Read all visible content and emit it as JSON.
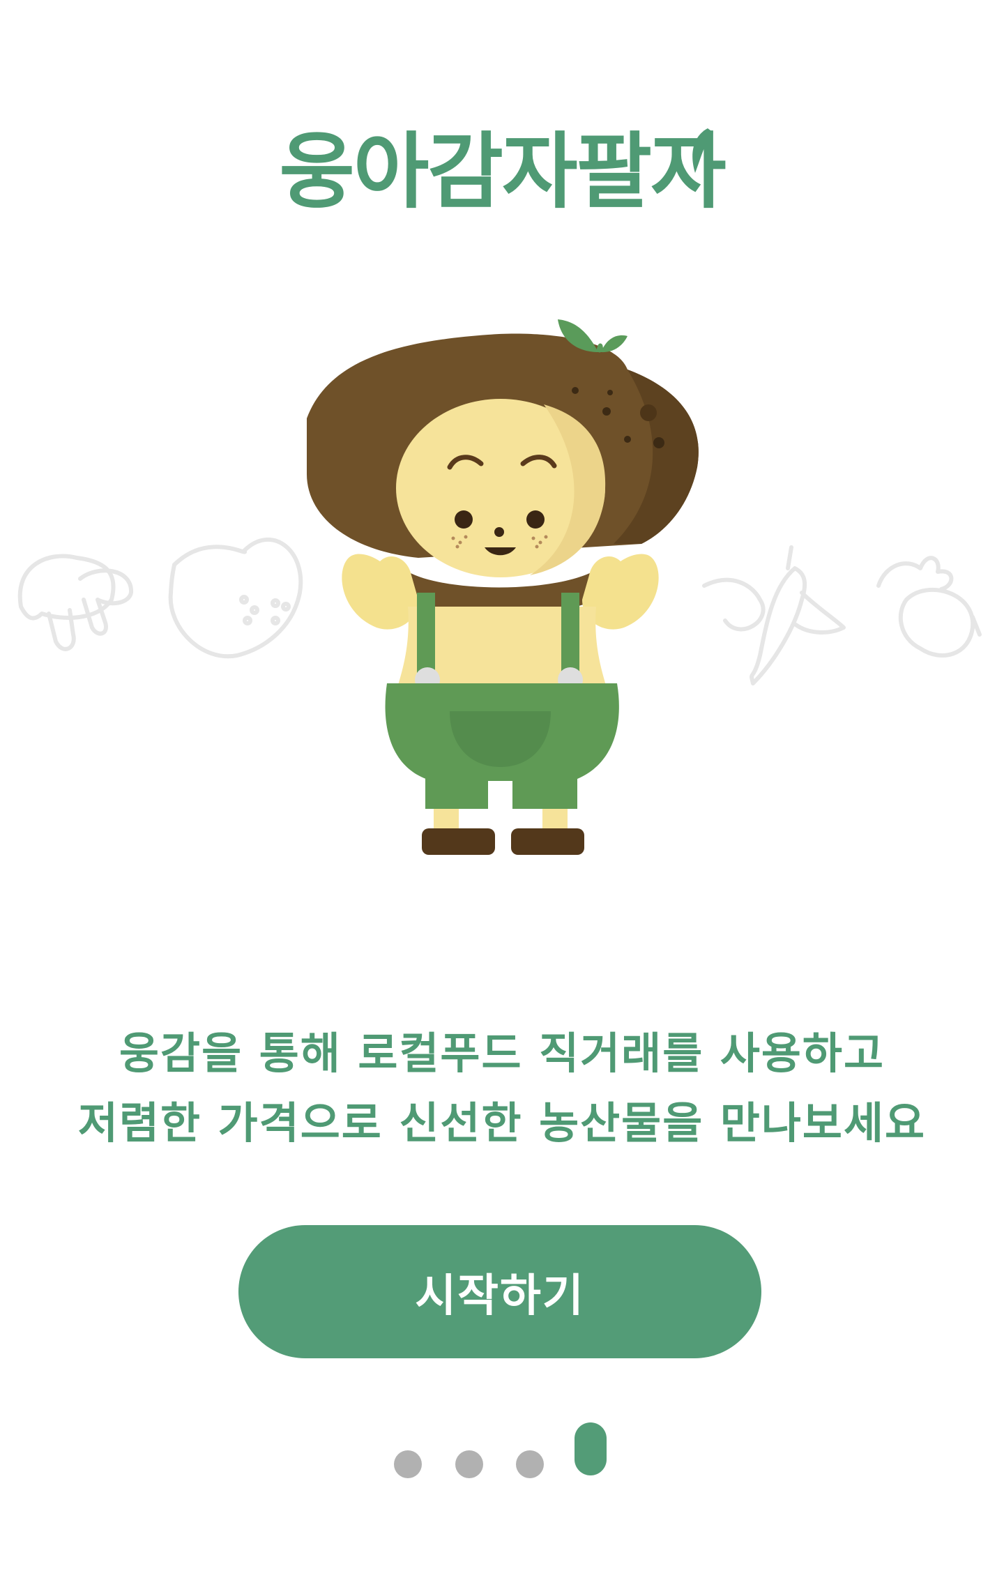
{
  "app": {
    "logo_text": "웅아감자팔자"
  },
  "intro": {
    "line1": "웅감을 통해 로컬푸드 직거래를 사용하고",
    "line2": "저렴한 가격으로 신선한 농산물을 만나보세요"
  },
  "actions": {
    "start_label": "시작하기"
  },
  "pager": {
    "total": 4,
    "current": 4
  },
  "theme": {
    "accent": "#539c77",
    "dot_inactive": "#b1b1b1"
  },
  "icons": [
    "mushroom-icon",
    "potato-icon",
    "pepper-icon",
    "radish-icon",
    "leaf-icon"
  ]
}
